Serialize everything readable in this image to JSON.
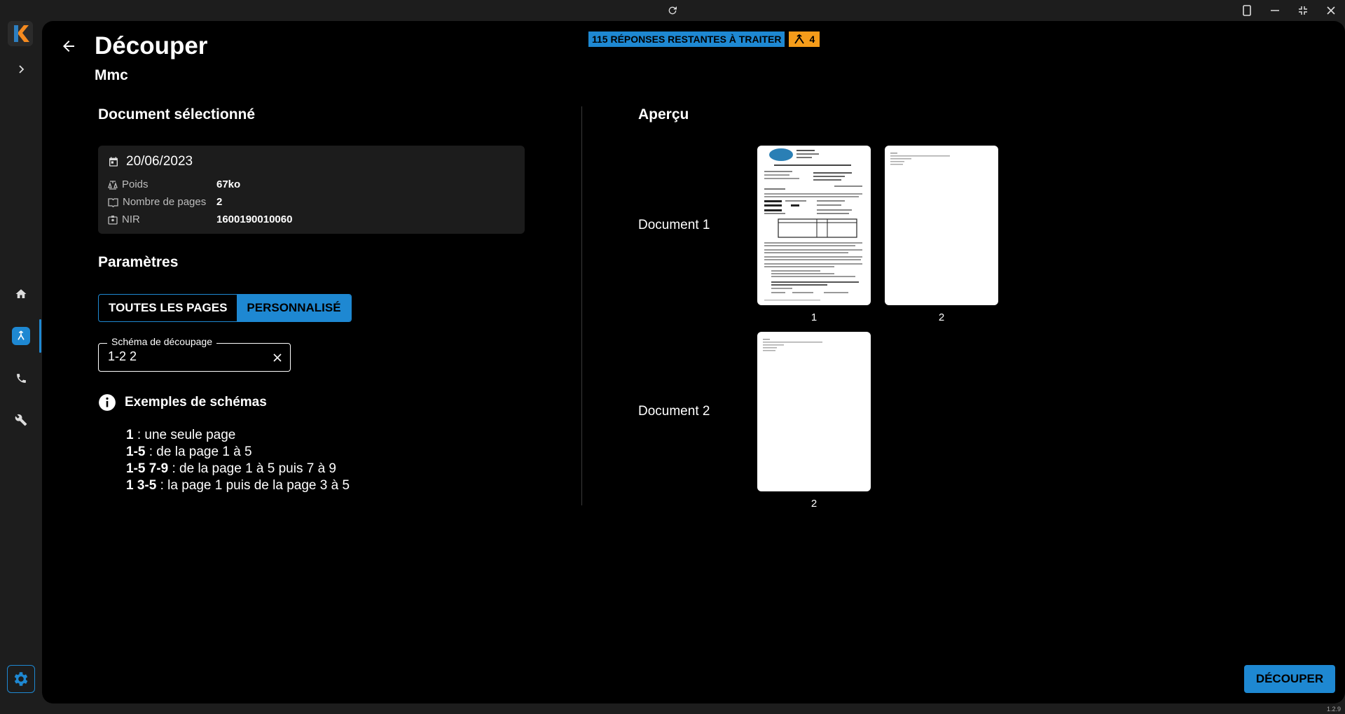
{
  "header": {
    "title": "Découper",
    "subtitle": "Mmc",
    "remaining_badge": "115 RÉPONSES RESTANTES À TRAITER",
    "split_count_badge": "4"
  },
  "document": {
    "section_title": "Document sélectionné",
    "date": "20/06/2023",
    "rows": [
      {
        "label": "Poids",
        "value": "67ko"
      },
      {
        "label": "Nombre de pages",
        "value": "2"
      },
      {
        "label": "NIR",
        "value": "1600190010060"
      }
    ]
  },
  "params": {
    "section_title": "Paramètres",
    "toggle_all": "TOUTES LES PAGES",
    "toggle_custom": "PERSONNALISÉ",
    "selected": "PERSONNALISÉ",
    "field_label": "Schéma de découpage",
    "field_value": "1-2 2"
  },
  "examples": {
    "title": "Exemples de schémas",
    "items": [
      {
        "code": "1",
        "text": " : une seule page"
      },
      {
        "code": "1-5",
        "text": " : de la page 1 à 5"
      },
      {
        "code": "1-5 7-9",
        "text": " : de la page 1 à 5 puis 7 à 9"
      },
      {
        "code": "1 3-5",
        "text": " : la page 1 puis de la page 3 à 5"
      }
    ]
  },
  "preview": {
    "section_title": "Aperçu",
    "documents": [
      {
        "label": "Document 1",
        "pages": [
          "1",
          "2"
        ]
      },
      {
        "label": "Document 2",
        "pages": [
          "2"
        ]
      }
    ]
  },
  "actions": {
    "cut_label": "DÉCOUPER"
  },
  "app": {
    "logo_letter": "K",
    "version": "1.2.9"
  },
  "colors": {
    "accent": "#1e88d2",
    "warning": "#f59c1a",
    "logo_orange": "#f58a1f"
  }
}
